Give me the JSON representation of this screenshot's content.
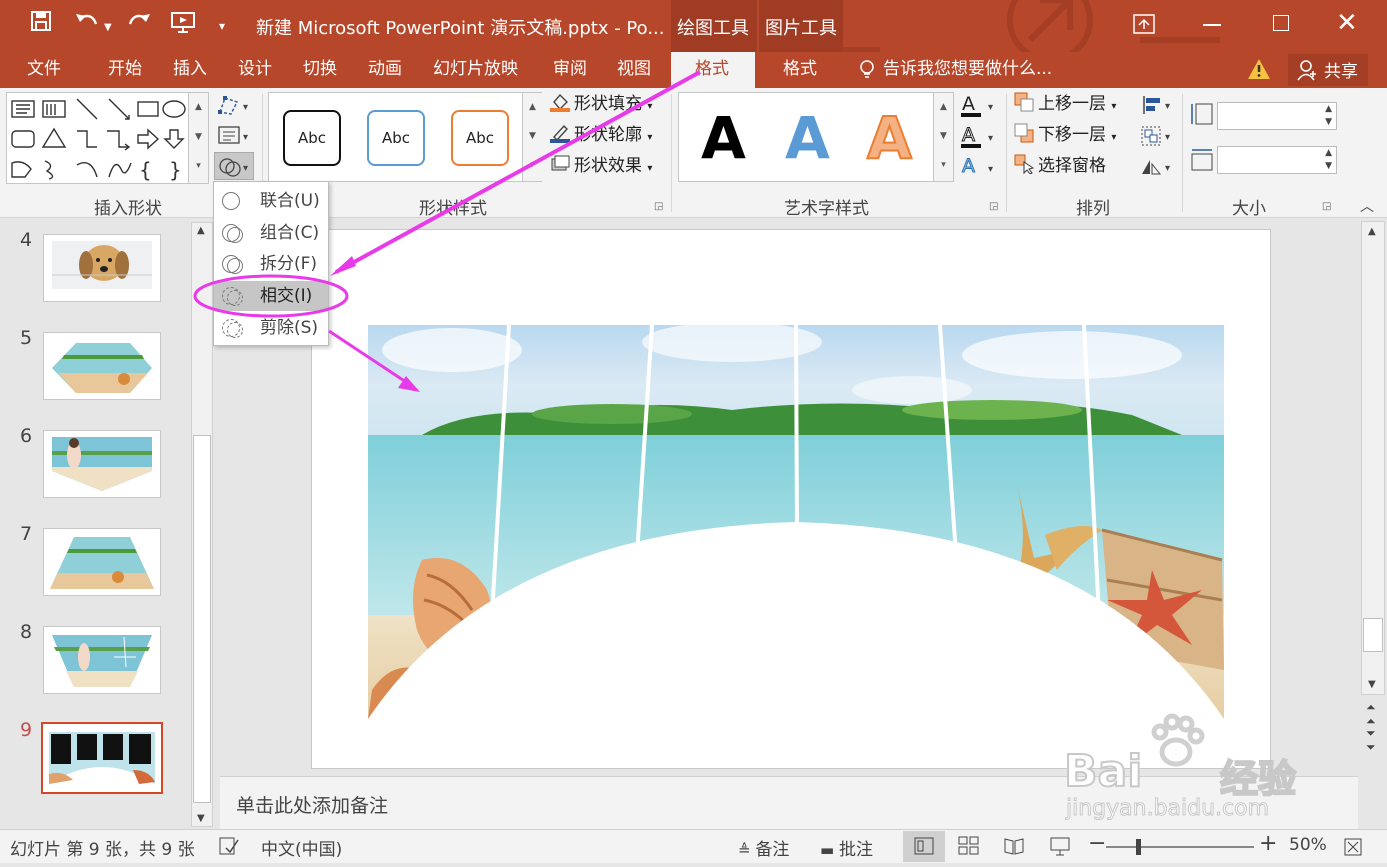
{
  "title_bar": {
    "doc_title": "新建 Microsoft PowerPoint 演示文稿.pptx - Po...",
    "context_tab_drawing": "绘图工具",
    "context_tab_picture": "图片工具",
    "min_icon": "minimize-icon",
    "max_icon": "maximize-icon",
    "close_icon": "close-icon",
    "accent_color": "#b7472a"
  },
  "tabs": {
    "file": "文件",
    "home": "开始",
    "insert": "插入",
    "design": "设计",
    "transitions": "切换",
    "animations": "动画",
    "slideshow": "幻灯片放映",
    "review": "审阅",
    "view": "视图",
    "format_drawing": "格式",
    "format_picture": "格式",
    "tell_me": "告诉我您想要做什么...",
    "share": "共享"
  },
  "ribbon": {
    "group_insert_shapes": "插入形状",
    "group_shape_styles": "形状样式",
    "group_wordart": "艺术字样式",
    "group_arrange": "排列",
    "group_size": "大小",
    "style_abc": [
      "Abc",
      "Abc",
      "Abc"
    ],
    "shape_fill": "形状填充",
    "shape_outline": "形状轮廓",
    "shape_effects": "形状效果",
    "wordart_letter": [
      "A",
      "A",
      "A"
    ],
    "bring_forward": "上移一层",
    "send_backward": "下移一层",
    "selection_pane": "选择窗格",
    "height_value": "",
    "width_value": ""
  },
  "merge_menu": {
    "items": [
      "联合(U)",
      "组合(C)",
      "拆分(F)",
      "相交(I)",
      "剪除(S)"
    ],
    "highlighted": "相交(I)"
  },
  "thumbnails": {
    "numbers": [
      "4",
      "5",
      "6",
      "7",
      "8",
      "9"
    ],
    "active": "9"
  },
  "notes_placeholder": "单击此处添加备注",
  "status": {
    "slide_info": "幻灯片 第 9 张，共 9 张",
    "language": "中文(中国)",
    "notes": "备注",
    "comments": "批注",
    "zoom": "50%"
  },
  "watermark": {
    "line1": "Bai",
    "line1b": "经验",
    "line2": "jingyan.baidu.com"
  }
}
